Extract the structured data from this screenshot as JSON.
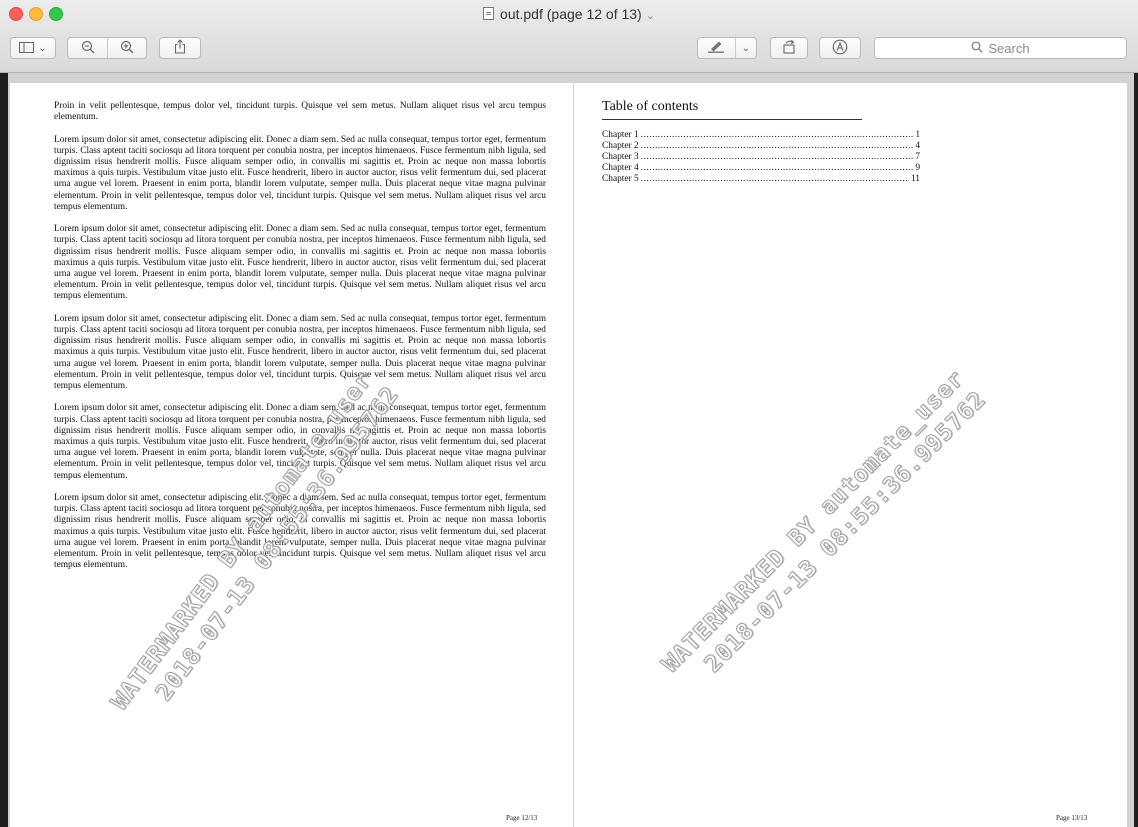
{
  "window": {
    "title": "out.pdf (page 12 of 13)",
    "title_caret": "⌄"
  },
  "toolbar": {
    "sidebar_caret": "⌄",
    "markup_caret": "⌄",
    "search_placeholder": "Search",
    "icons": [
      "sidebar-icon",
      "zoom-out-icon",
      "zoom-in-icon",
      "share-icon",
      "highlight-pen-icon",
      "rotate-icon",
      "markup-icon",
      "search-icon"
    ]
  },
  "left_page": {
    "paragraphs": [
      "Proin in velit pellentesque, tempus dolor vel, tincidunt turpis. Quisque vel sem metus. Nullam aliquet risus vel arcu tempus elementum.",
      "Lorem ipsum dolor sit amet, consectetur adipiscing elit. Donec a diam sem. Sed ac nulla consequat, tempus tortor eget, fermentum turpis. Class aptent taciti sociosqu ad litora torquent per conubia nostra, per inceptos himenaeos. Fusce fermentum nibh ligula, sed dignissim risus hendrerit mollis. Fusce aliquam semper odio, in convallis mi sagittis et. Proin ac neque non massa lobortis maximus a quis turpis. Vestibulum vitae justo elit. Fusce hendrerit, libero in auctor auctor, risus velit fermentum dui, sed placerat urna augue vel lorem. Praesent in enim porta, blandit lorem vulputate, semper nulla. Duis placerat neque vitae magna pulvinar elementum. Proin in velit pellentesque, tempus dolor vel, tincidunt turpis. Quisque vel sem metus. Nullam aliquet risus vel arcu tempus elementum.",
      "Lorem ipsum dolor sit amet, consectetur adipiscing elit. Donec a diam sem. Sed ac nulla consequat, tempus tortor eget, fermentum turpis. Class aptent taciti sociosqu ad litora torquent per conubia nostra, per inceptos himenaeos. Fusce fermentum nibh ligula, sed dignissim risus hendrerit mollis. Fusce aliquam semper odio, in convallis mi sagittis et. Proin ac neque non massa lobortis maximus a quis turpis. Vestibulum vitae justo elit. Fusce hendrerit, libero in auctor auctor, risus velit fermentum dui, sed placerat urna augue vel lorem. Praesent in enim porta, blandit lorem vulputate, semper nulla. Duis placerat neque vitae magna pulvinar elementum. Proin in velit pellentesque, tempus dolor vel, tincidunt turpis. Quisque vel sem metus. Nullam aliquet risus vel arcu tempus elementum.",
      "Lorem ipsum dolor sit amet, consectetur adipiscing elit. Donec a diam sem. Sed ac nulla consequat, tempus tortor eget, fermentum turpis. Class aptent taciti sociosqu ad litora torquent per conubia nostra, per inceptos himenaeos. Fusce fermentum nibh ligula, sed dignissim risus hendrerit mollis. Fusce aliquam semper odio, in convallis mi sagittis et. Proin ac neque non massa lobortis maximus a quis turpis. Vestibulum vitae justo elit. Fusce hendrerit, libero in auctor auctor, risus velit fermentum dui, sed placerat urna augue vel lorem. Praesent in enim porta, blandit lorem vulputate, semper nulla. Duis placerat neque vitae magna pulvinar elementum. Proin in velit pellentesque, tempus dolor vel, tincidunt turpis. Quisque vel sem metus. Nullam aliquet risus vel arcu tempus elementum.",
      "Lorem ipsum dolor sit amet, consectetur adipiscing elit. Donec a diam sem. Sed ac nulla consequat, tempus tortor eget, fermentum turpis. Class aptent taciti sociosqu ad litora torquent per conubia nostra, per inceptos himenaeos. Fusce fermentum nibh ligula, sed dignissim risus hendrerit mollis. Fusce aliquam semper odio, in convallis mi sagittis et. Proin ac neque non massa lobortis maximus a quis turpis. Vestibulum vitae justo elit. Fusce hendrerit, libero in auctor auctor, risus velit fermentum dui, sed placerat urna augue vel lorem. Praesent in enim porta, blandit lorem vulputate, semper nulla. Duis placerat neque vitae magna pulvinar elementum. Proin in velit pellentesque, tempus dolor vel, tincidunt turpis. Quisque vel sem metus. Nullam aliquet risus vel arcu tempus elementum.",
      "Lorem ipsum dolor sit amet, consectetur adipiscing elit. Donec a diam sem. Sed ac nulla consequat, tempus tortor eget, fermentum turpis. Class aptent taciti sociosqu ad litora torquent per conubia nostra, per inceptos himenaeos. Fusce fermentum nibh ligula, sed dignissim risus hendrerit mollis. Fusce aliquam semper odio, in convallis mi sagittis et. Proin ac neque non massa lobortis maximus a quis turpis. Vestibulum vitae justo elit. Fusce hendrerit, libero in auctor auctor, risus velit fermentum dui, sed placerat urna augue vel lorem. Praesent in enim porta, blandit lorem vulputate, semper nulla. Duis placerat neque vitae magna pulvinar elementum. Proin in velit pellentesque, tempus dolor vel, tincidunt turpis. Quisque vel sem metus. Nullam aliquet risus vel arcu tempus elementum."
    ],
    "page_label": "Page 12/13",
    "watermark_line1": "WATERMARKED BY automate_user",
    "watermark_line2": "2018-07-13 08:55:36.995762"
  },
  "right_page": {
    "toc_title": "Table of contents",
    "toc": [
      {
        "label": "Chapter 1",
        "page": "1"
      },
      {
        "label": "Chapter 2",
        "page": "4"
      },
      {
        "label": "Chapter 3",
        "page": "7"
      },
      {
        "label": "Chapter 4",
        "page": "9"
      },
      {
        "label": "Chapter 5",
        "page": "11"
      }
    ],
    "page_label": "Page 13/13",
    "watermark_line1": "WATERMARKED BY automate_user",
    "watermark_line2": "2018-07-13 08:55:36.995762"
  }
}
